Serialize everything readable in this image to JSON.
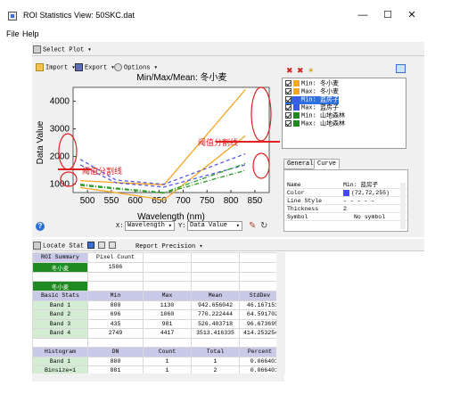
{
  "window": {
    "title": "ROI Statistics View: 50SKC.dat",
    "minimize": "—",
    "maximize": "☐",
    "close": "✕"
  },
  "menu": {
    "file": "File",
    "help": "Help"
  },
  "toolbar": {
    "select_plot": "Select Plot ▾",
    "import": "Import ▾",
    "export": "Export ▾",
    "options": "Options ▾"
  },
  "chart_data": {
    "type": "line",
    "title": "Min/Max/Mean: 冬小麦",
    "xlabel": "Wavelength (nm)",
    "ylabel": "Data Value",
    "xlim": [
      470,
      880
    ],
    "ylim": [
      700,
      4500
    ],
    "xticks": [
      500,
      550,
      600,
      650,
      700,
      750,
      800,
      850
    ],
    "yticks": [
      1000,
      2000,
      3000,
      4000
    ],
    "x": [
      485,
      560,
      660,
      830
    ],
    "series": [
      {
        "color": "#f5a623",
        "style": "solid",
        "values": [
          1130,
          1060,
          981,
          4417
        ]
      },
      {
        "color": "#f5a623",
        "style": "solid",
        "values": [
          880,
          696,
          435,
          2749
        ]
      },
      {
        "color": "#5a5ae6",
        "style": "dashed",
        "values": [
          1900,
          1150,
          1000,
          2100
        ]
      },
      {
        "color": "#5a5ae6",
        "style": "dashed",
        "values": [
          1700,
          1050,
          900,
          1700
        ]
      },
      {
        "color": "#2a9d2a",
        "style": "dashdot",
        "values": [
          1000,
          860,
          700,
          1750
        ]
      },
      {
        "color": "#2a9d2a",
        "style": "dashdot",
        "values": [
          960,
          830,
          680,
          1500
        ]
      }
    ],
    "annotations": [
      "阈值分割线",
      "阈值分割线"
    ]
  },
  "plot_footer": {
    "x_axis_label": "X:",
    "x_axis_value": "Wavelength",
    "y_axis_label": "Y:",
    "y_axis_value": "Data Value"
  },
  "legend": {
    "items": [
      {
        "label": "Min: 冬小麦",
        "color": "#f5a623"
      },
      {
        "label": "Max: 冬小麦",
        "color": "#f5a623"
      },
      {
        "label": "Min: 蓝房子",
        "color": "#3a5ae6",
        "selected": true
      },
      {
        "label": "Max: 蓝房子",
        "color": "#3a5ae6"
      },
      {
        "label": "Min: 山地森林",
        "color": "#1f8a1f"
      },
      {
        "label": "Max: 山地森林",
        "color": "#1f8a1f"
      }
    ]
  },
  "tabs": {
    "general": "General",
    "curve": "Curve"
  },
  "props": [
    {
      "k": "Name",
      "v": "Min: 蓝房子"
    },
    {
      "k": "Color",
      "v": "(72,72,255)"
    },
    {
      "k": "Line Style",
      "v": "– – – – –"
    },
    {
      "k": "Thickness",
      "v": "2"
    },
    {
      "k": "Symbol",
      "v": "No symbol"
    }
  ],
  "locate": {
    "locate_stat": "Locate Stat ▾",
    "report_precision": "Report Precision ▾"
  },
  "table": {
    "roi_summary": [
      "ROI Summary",
      "Pixel Count"
    ],
    "roi1": {
      "name": "冬小麦",
      "count": "1506"
    },
    "roi_label": "冬小麦",
    "basic_header": [
      "Basic Stats",
      "Min",
      "Max",
      "Mean",
      "StdDev"
    ],
    "basic_rows": [
      [
        "Band 1",
        "880",
        "1130",
        "942.656042",
        "46.167151"
      ],
      [
        "Band 2",
        "696",
        "1060",
        "770.222444",
        "64.591702"
      ],
      [
        "Band 3",
        "435",
        "981",
        "526.403718",
        "96.673695"
      ],
      [
        "Band 4",
        "2749",
        "4417",
        "3513.416335",
        "414.253254"
      ]
    ],
    "hist_header": [
      "Histogram",
      "DN",
      "Count",
      "Total",
      "Percent"
    ],
    "hist_rows": [
      [
        "Band 1",
        "880",
        "1",
        "1",
        "0.066401"
      ],
      [
        "Binsize=1",
        "881",
        "1",
        "2",
        "0.066401"
      ]
    ]
  }
}
